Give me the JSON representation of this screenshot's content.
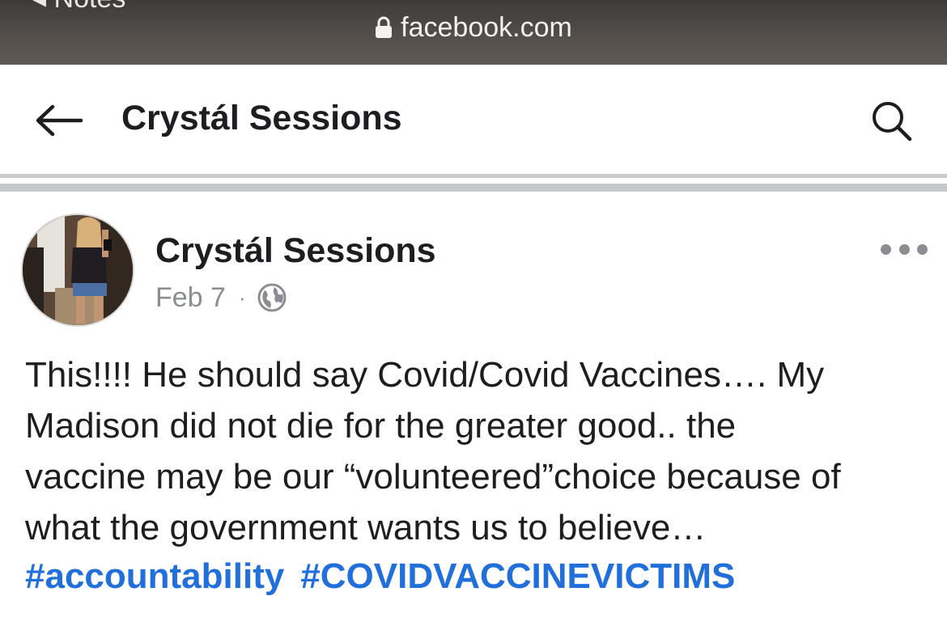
{
  "browser": {
    "back_label": "◂ Notes",
    "url": "facebook.com"
  },
  "header": {
    "title": "Crystál Sessions"
  },
  "post": {
    "author": "Crystál Sessions",
    "date": "Feb 7",
    "separator": "·",
    "privacy_icon": "globe-icon",
    "text_lines": [
      "This!!!! He should say Covid/Covid Vaccines…. My",
      "Madison did not die for the greater good.. the",
      "vaccine may be our “volunteered”choice because of",
      "what the government wants us to believe…"
    ],
    "hashtags": [
      "#accountability",
      "#COVIDVACCINEVICTIMS"
    ]
  },
  "colors": {
    "hashtag": "#216fdb",
    "text": "#1c1e21",
    "muted": "#8a8d91",
    "browser_bar": "#4a4541"
  }
}
